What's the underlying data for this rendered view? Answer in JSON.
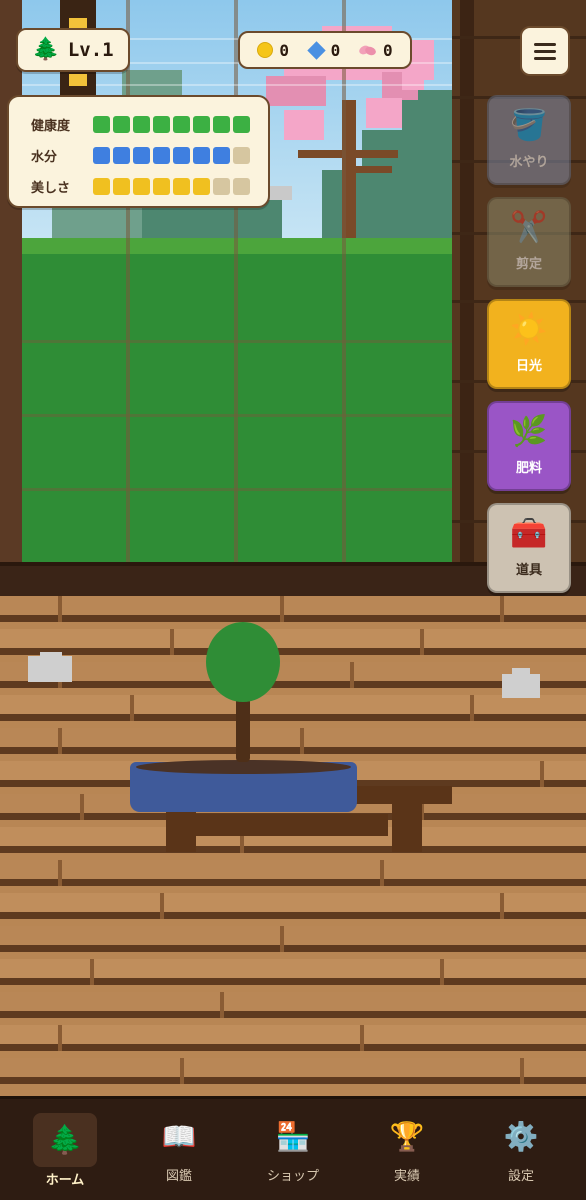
{
  "player": {
    "level": "Lv.1",
    "level_icon": "pine-tree-icon"
  },
  "currency": [
    {
      "name": "coin",
      "icon": "coin-icon",
      "value": "0",
      "color": "#f5c518"
    },
    {
      "name": "gem",
      "icon": "gem-icon",
      "value": "0",
      "color": "#4a90e2"
    },
    {
      "name": "petal",
      "icon": "petal-icon",
      "value": "0",
      "color": "#f2a0b8"
    }
  ],
  "stats": [
    {
      "label": "健康度",
      "filled": 8,
      "total": 8,
      "color": "#3cb043"
    },
    {
      "label": "水分",
      "filled": 7,
      "total": 8,
      "color": "#3f7fe0"
    },
    {
      "label": "美しさ",
      "filled": 6,
      "total": 8,
      "color": "#f0c020"
    }
  ],
  "actions": [
    {
      "id": "water",
      "label": "水やり",
      "icon": "bucket-icon",
      "glyph": "🪣",
      "color": "#7d8aa6",
      "text_color": "#ffffff",
      "dimmed": true
    },
    {
      "id": "prune",
      "label": "剪定",
      "icon": "scissors-icon",
      "glyph": "✂️",
      "color": "#8c8a6a",
      "text_color": "#ffffff",
      "dimmed": true
    },
    {
      "id": "sun",
      "label": "日光",
      "icon": "sun-icon",
      "glyph": "☀️",
      "color": "#f2b21e",
      "text_color": "#ffffff",
      "dimmed": false
    },
    {
      "id": "fertilizer",
      "label": "肥料",
      "icon": "herb-icon",
      "glyph": "🌿",
      "color": "#9a55c6",
      "text_color": "#ffffff",
      "dimmed": false
    },
    {
      "id": "tools",
      "label": "道具",
      "icon": "toolbox-icon",
      "glyph": "🧰",
      "color": "#cdc2b2",
      "text_color": "#3a2a1c",
      "dimmed": false
    }
  ],
  "nav": [
    {
      "id": "home",
      "label": "ホーム",
      "icon": "pine-tree-icon",
      "glyph": "🌲",
      "active": true
    },
    {
      "id": "encyclopedia",
      "label": "図鑑",
      "icon": "book-icon",
      "glyph": "📖",
      "active": false
    },
    {
      "id": "shop",
      "label": "ショップ",
      "icon": "shop-icon",
      "glyph": "🏪",
      "active": false
    },
    {
      "id": "achievements",
      "label": "実績",
      "icon": "trophy-icon",
      "glyph": "🏆",
      "active": false
    },
    {
      "id": "settings",
      "label": "設定",
      "icon": "gear-icon",
      "glyph": "⚙️",
      "active": false
    }
  ]
}
